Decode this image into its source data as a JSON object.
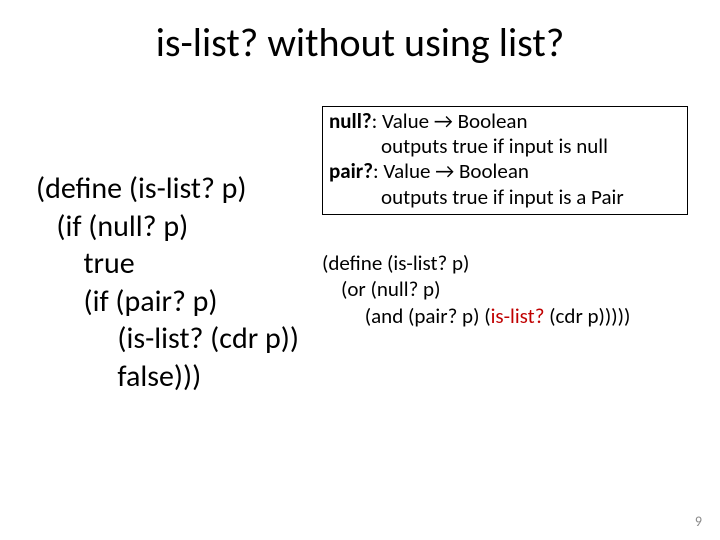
{
  "title": "is-list? without using list?",
  "code_left": {
    "l1": "(define (is-list? p)",
    "l2": "   (if (null? p)",
    "l3": "       true",
    "l4": "       (if (pair? p)",
    "l5": "            (is-list? (cdr p))",
    "l6": "            false)))"
  },
  "sig": {
    "null_name": "null?",
    "null_type": ": Value → Boolean",
    "null_desc": "outputs true if input is null",
    "pair_name": "pair?",
    "pair_type": ": Value → Boolean",
    "pair_desc": "outputs true if input is a Pair"
  },
  "right_code": {
    "l1": "(define (is-list? p)",
    "l2": "    (or (null? p)",
    "l3a": "         (and (pair? p) (",
    "l3b": "is-list?",
    "l3c": " (cdr p)))))"
  },
  "slide_number": "9"
}
